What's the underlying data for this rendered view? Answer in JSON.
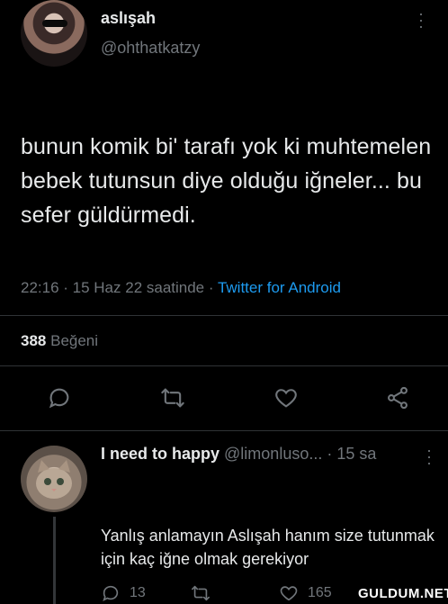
{
  "tweet": {
    "display_name": "aslışah",
    "handle": "@ohthatkatzy",
    "text": "bunun komik bi' tarafı yok ki muhtemelen bebek tutunsun diye olduğu iğneler... bu sefer güldürmedi.",
    "time_date": "22:16 · 15 Haz 22 saatinde · ",
    "source": "Twitter for Android",
    "likes_count": "388",
    "likes_label": "Beğeni"
  },
  "reply": {
    "display_name": "I need to happy",
    "handle": "@limonluso...",
    "time": "· 15 sa",
    "text": "Yanlış anlamayın Aslışah hanım size tutunmak için kaç iğne olmak gerekiyor",
    "reply_count": "13",
    "like_count": "165"
  },
  "watermark": "GULDUM.NET",
  "icons": [
    "more-icon",
    "reply-icon",
    "retweet-icon",
    "like-icon",
    "share-icon"
  ],
  "colors": {
    "background": "#000000",
    "text": "#e7e9ea",
    "muted": "#71767b",
    "accent": "#1d9bf0"
  }
}
